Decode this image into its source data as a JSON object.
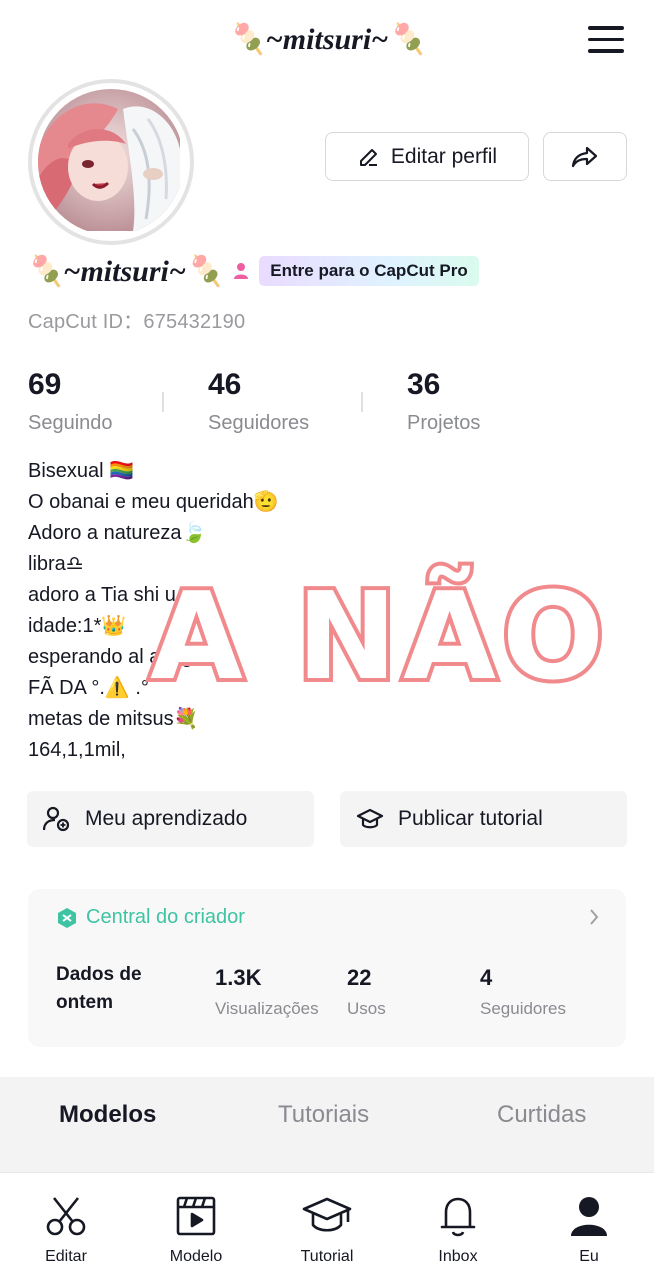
{
  "header": {
    "title": "🍡~mitsuri~🍡",
    "menu_icon": "hamburger-menu-icon"
  },
  "profile": {
    "display_name": "🍡~mitsuri~🍡",
    "gender_icon": "person-icon",
    "pro_badge": "Entre para o CapCut Pro",
    "capcut_id": "CapCut ID：675432190",
    "edit_button": "Editar perfil",
    "edit_icon": "pencil-icon",
    "share_icon": "share-arrow-icon"
  },
  "stats": [
    {
      "value": "69",
      "label": "Seguindo"
    },
    {
      "value": "46",
      "label": "Seguidores"
    },
    {
      "value": "36",
      "label": "Projetos"
    }
  ],
  "bio": [
    "Bisexual 🏳️‍🌈",
    "O  obanai e meu queridah🫡",
    "Adoro a natureza🍃",
    "libra♎",
    "adoro a Tia shi   u",
    "idade:1*👑",
    "esperando al         amigar😊",
    "FÃ DA °.⚠️      .°",
    "metas de mitsus💐",
    "164,1,1mil,"
  ],
  "overlay_text": "A NÃO",
  "actions": {
    "learning": "Meu aprendizado",
    "publish": "Publicar tutorial"
  },
  "creator": {
    "title": "Central do criador",
    "label": "Dados de ontem",
    "metrics": [
      {
        "value": "1.3K",
        "label": "Visualizações"
      },
      {
        "value": "22",
        "label": "Usos"
      },
      {
        "value": "4",
        "label": "Seguidores"
      }
    ]
  },
  "tabs": [
    "Modelos",
    "Tutoriais",
    "Curtidas"
  ],
  "nav": [
    {
      "label": "Editar",
      "icon": "scissors-icon"
    },
    {
      "label": "Modelo",
      "icon": "clapperboard-icon"
    },
    {
      "label": "Tutorial",
      "icon": "graduation-cap-icon"
    },
    {
      "label": "Inbox",
      "icon": "bell-icon"
    },
    {
      "label": "Eu",
      "icon": "user-icon"
    }
  ],
  "colors": {
    "accent_green": "#3fc4a3",
    "overlay_stroke": "#f08a8d",
    "text_primary": "#161823",
    "text_secondary": "#8a8b91"
  }
}
